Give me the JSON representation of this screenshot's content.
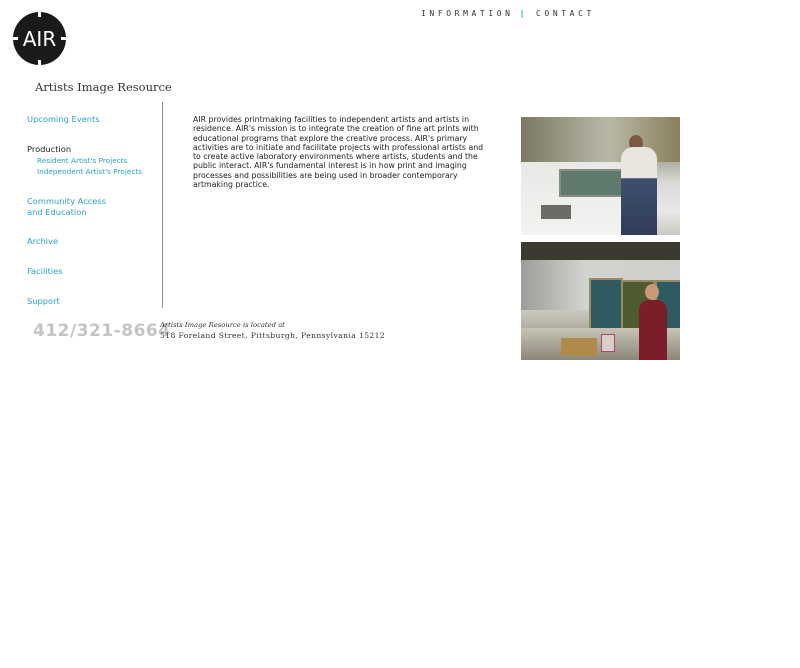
{
  "logo": {
    "text": "AIR"
  },
  "topnav": {
    "information": "information",
    "separator": "|",
    "contact": "contact"
  },
  "org_name": "Artists Image Resource",
  "sidebar": {
    "upcoming_events": "Upcoming Events",
    "production": "Production",
    "resident_projects": "Resident Artist's Projects",
    "independent_projects": "Independent Artist's Projects",
    "community_access_1": "Community Access",
    "community_access_2": "and Education",
    "archive": "Archive",
    "facilities": "Facilities",
    "support": "Support"
  },
  "main": {
    "intro": "AIR provides printmaking facilities to independent artists and artists in residence. AIR's mission is to integrate the creation of fine art prints with educational programs that explore the creative process. AIR's primary activities are to initiate and facilitate projects with professional artists and to create active laboratory environments where artists, students and the public interact. AIR's fundamental interest is in how print and imaging processes and possibilities are being used in broader contemporary artmaking practice."
  },
  "footer": {
    "phone": "412/321-8664",
    "located_label": "Artists Image Resource is located at",
    "address": "518 Foreland Street, Pittsburgh, Pennsylvania 15212"
  },
  "colors": {
    "accent": "#2aa3c8",
    "text": "#222222",
    "phone_gray": "#c4c4c4",
    "logo_bg": "#1a1a1a"
  }
}
